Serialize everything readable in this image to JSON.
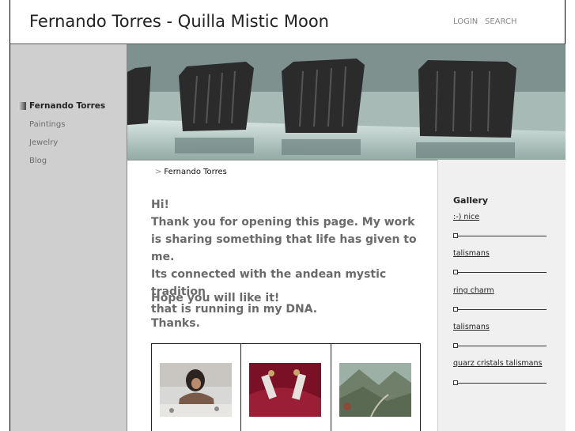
{
  "header": {
    "title": "Fernando Torres - Quilla Mistic Moon",
    "login": "LOGIN",
    "search": "SEARCH"
  },
  "sidebar": {
    "items": [
      {
        "label": "Fernando Torres",
        "active": true
      },
      {
        "label": "Paintings",
        "active": false
      },
      {
        "label": "Jewelry",
        "active": false
      },
      {
        "label": "Blog",
        "active": false
      }
    ]
  },
  "breadcrumb": {
    "separator": ">",
    "current": "Fernando Torres"
  },
  "content": {
    "lines": [
      "Hi!",
      "Thank you for opening this page. My work",
      "is sharing something that life has given to me.",
      "Its connected with the andean mystic tradition",
      "that is running in my DNA."
    ],
    "hope": "Hope you will like it!",
    "thanks": "Thanks."
  },
  "gallery_panel": {
    "title": "Gallery",
    "links": [
      ":-) nice",
      "talismans",
      "ring charm",
      "talismans",
      "quarz cristals talismans"
    ]
  },
  "colors": {
    "sidebar_bg": "#cfcfcf",
    "right_panel_bg": "#f0f0f0",
    "content_text": "#6a6a6a"
  }
}
